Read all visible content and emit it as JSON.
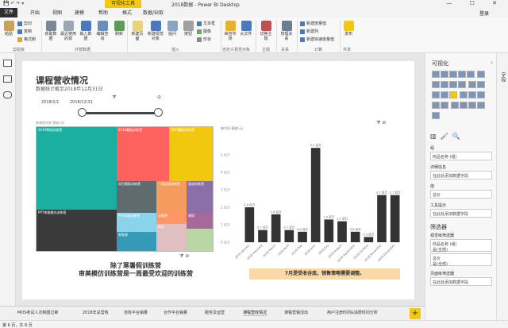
{
  "window": {
    "quick_access": "💾 ↶ ↷ ▾",
    "context_tab": "可视化工具",
    "title": "2018数据 - Power BI Desktop",
    "controls": "— ☐ ✕"
  },
  "tabs": [
    "开始",
    "视图",
    "建模",
    "帮助",
    "格式",
    "数据/钻取"
  ],
  "file_tab": "文件",
  "login": "登录",
  "ribbon": {
    "clipboard": {
      "paste": "粘贴",
      "cut": "剪切",
      "copy": "复制",
      "format_painter": "格式刷",
      "group": "剪贴板"
    },
    "external": {
      "get_data": "获取数据",
      "recent_sources": "最近使用的源",
      "enter_data": "输入数据",
      "edit_queries": "编辑查询",
      "refresh": "刷新",
      "group": "外部数据"
    },
    "insert": {
      "new_page": "新建页面",
      "new_visual": "新建视觉对象",
      "ask": "提问",
      "button": "按钮",
      "textbox": "文本框",
      "image": "图像",
      "shapes": "形状",
      "group": "插入"
    },
    "custom": {
      "from_market": "来自市场",
      "from_file": "从文件",
      "group": "自定义视觉对象"
    },
    "theme": {
      "switch_theme": "切换主题",
      "group": "主题"
    },
    "relations": {
      "manage": "管理关系",
      "group": "关系"
    },
    "calc": {
      "new_measure": "新建度量值",
      "new_column": "新建列",
      "new_quick_measure": "新建快速度量值",
      "group": "计算"
    },
    "share": {
      "publish": "发布",
      "group": "共享"
    }
  },
  "report": {
    "title": "课程营收情况",
    "subtitle": "数据统计截至2018年12月31日",
    "slicer_start": "2018/1/1",
    "slicer_end": "2018/12/31",
    "treemap_header": "按课程名称 营收(元)",
    "note_left_1": "除了寒暑假训练营",
    "note_left_2": "审美模仿训练营是一周最受欢迎的训练营",
    "note_right": "7月是受收谷底，销售策略需要调整。",
    "chart_header": "按月份 营收(元)"
  },
  "treemap": [
    {
      "label": "2019寒假训练营",
      "color": "#1aafa0"
    },
    {
      "label": "2018暑假训练营",
      "color": "#fd625e"
    },
    {
      "label": "2018暑假训练营",
      "color": "#f2c80f"
    },
    {
      "label": "PPT审美模仿训练营",
      "color": "#3a3a3a"
    },
    {
      "label": "科目模板训练营",
      "color": "#5f6b6d"
    },
    {
      "label": "一周速成训练营",
      "color": "#f49c5e"
    },
    {
      "label": "速成训练营",
      "color": "#8a6fa8"
    },
    {
      "label": "PPT高级训练营",
      "color": "#8ad4eb"
    },
    {
      "label": "训练营",
      "color": "#fe9666"
    },
    {
      "label": "课程",
      "color": "#a66999"
    },
    {
      "label": "视频课",
      "color": "#3599b8"
    },
    {
      "label": "精品",
      "color": "#dfbfbf"
    }
  ],
  "chart_data": {
    "type": "bar",
    "categories": [
      "2018 January",
      "2018 February",
      "2018 March",
      "2018 April",
      "2018 May",
      "2018 June",
      "2018 July",
      "2018 August",
      "2018 September",
      "2018 October",
      "2018 November",
      "2018 December"
    ],
    "values": [
      2.0,
      0.7,
      1.6,
      0.7,
      0.6,
      5.4,
      1.3,
      1.2,
      0.6,
      0.3,
      2.7,
      2.7
    ],
    "data_labels": [
      "2.0 百万",
      "0.7 百万",
      "1.6 百万",
      "0.7 百万",
      "0.6 百万",
      "5.4 百万",
      "1.3 百万",
      "1.2 百万",
      "0.6 百万",
      "0.3 百万",
      "2.7 百万",
      "2.7 百万"
    ],
    "y_ticks": [
      "0 百万",
      "1 百万",
      "2 百万",
      "3 百万",
      "4 百万",
      "5 百万"
    ],
    "ylim": [
      0,
      6
    ],
    "color": "#333333"
  },
  "page_tabs": [
    "MOS考试人次制图过审",
    "2018年总营收",
    "自有平台销量",
    "合作平台销量",
    "服务及运营",
    "课程营收情况",
    "课程营销活动",
    "用户注册时间&消费时间分析"
  ],
  "active_tab_index": 5,
  "status": "第 6 页，共 8 页",
  "viz_pane": {
    "title": "可视化",
    "fields_tab": "字段",
    "wells": {
      "group": "组",
      "group_value": "商品名称 (组)",
      "details": "详细信息",
      "details_value": "在此处添加数据字段",
      "values": "值",
      "values_value": "总价",
      "tooltip": "工具提示",
      "tooltip_value": "在此处添加数据字段",
      "filters": "筛选器",
      "visual_filter": "视觉级筛选器",
      "f1": "商品名称 (组)",
      "f1b": "是(全部)",
      "f2": "总价",
      "f2b": "是(全部)",
      "page_filter": "页面级筛选器",
      "page_filter_value": "在此处添加数据字段"
    }
  }
}
